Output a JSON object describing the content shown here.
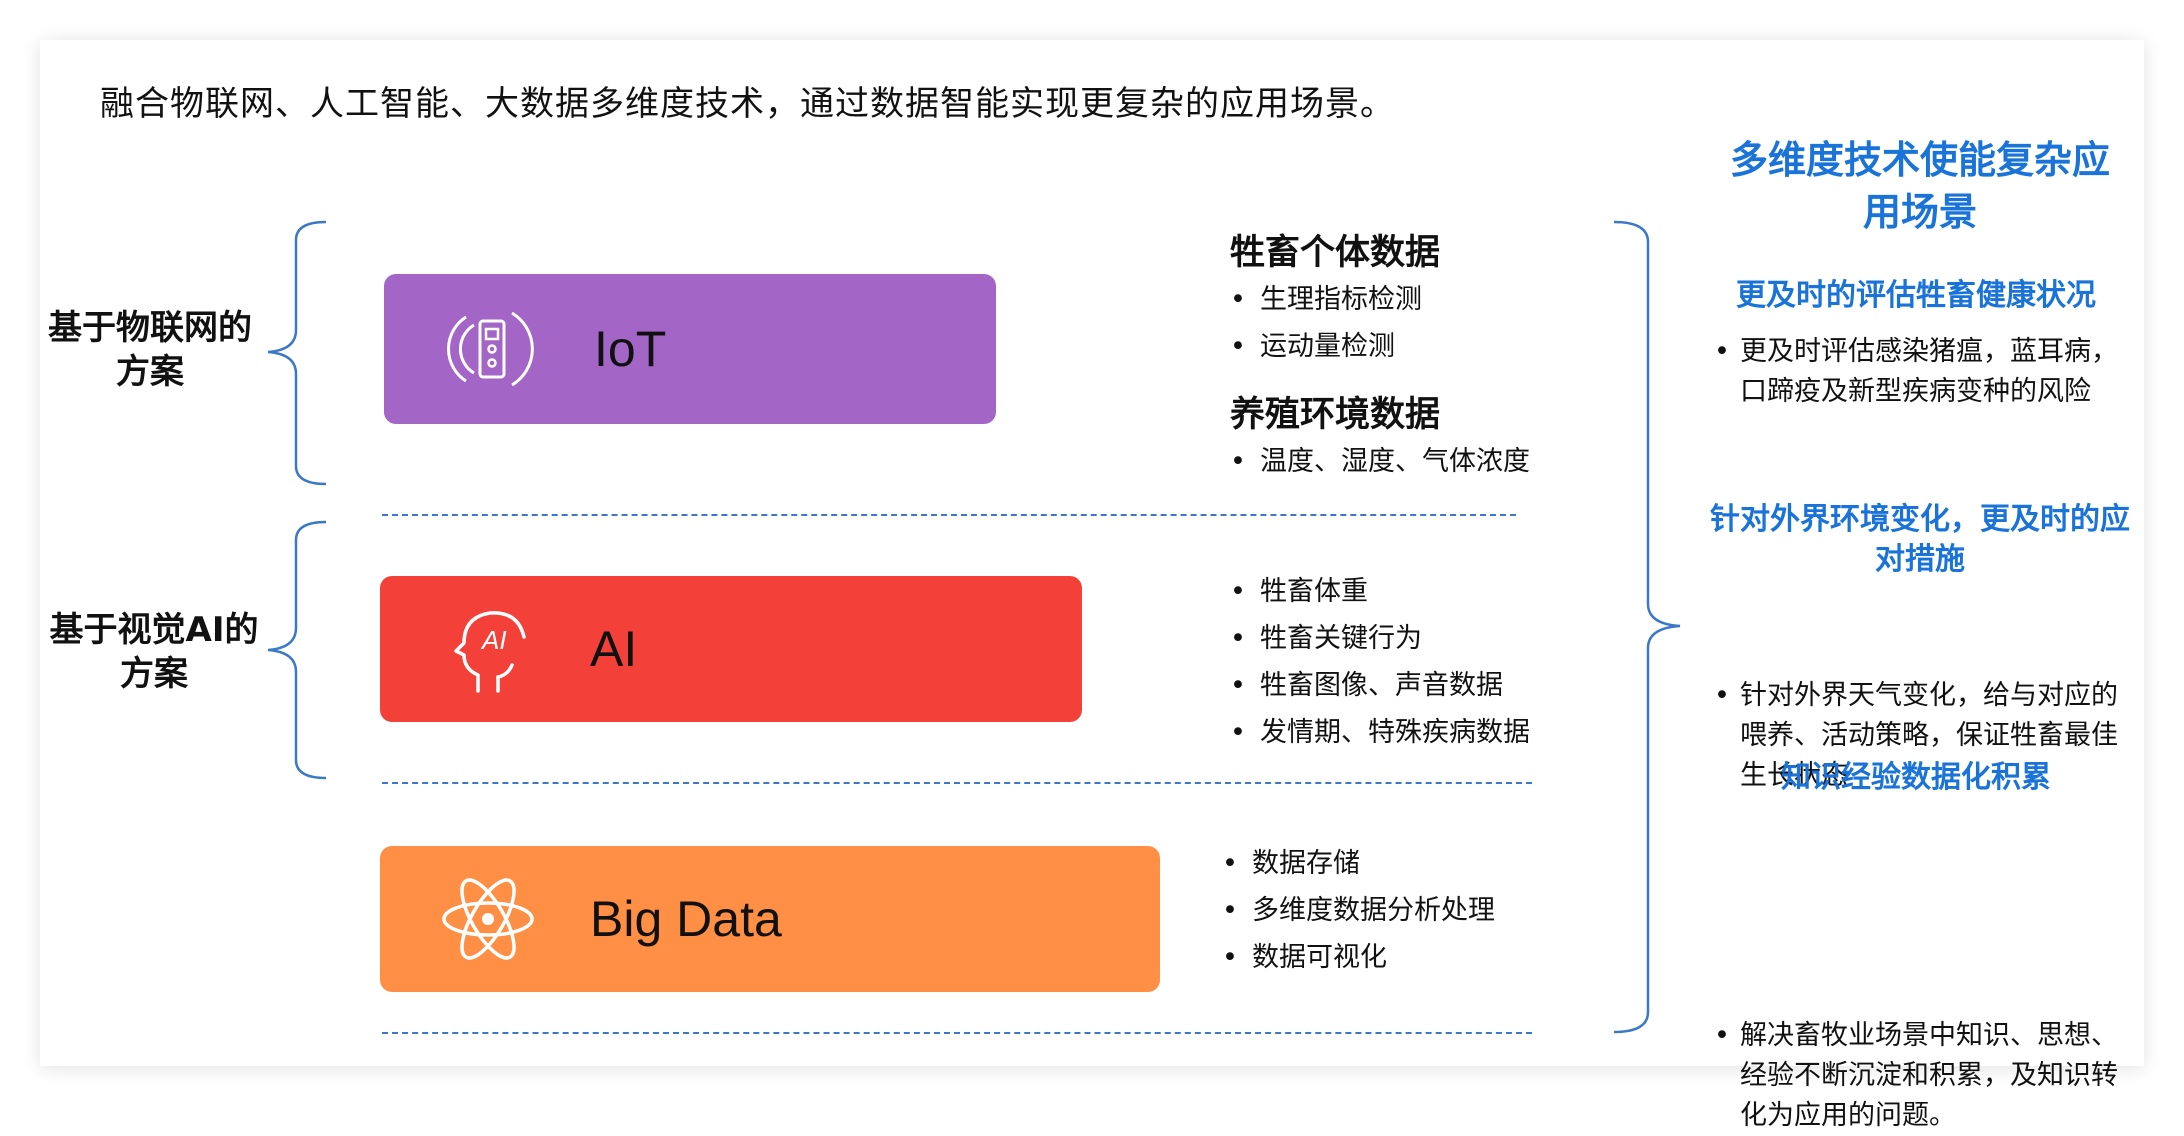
{
  "headline": "融合物联网、人工智能、大数据多维度技术，通过数据智能实现更复杂的应用场景。",
  "groups": [
    {
      "label": "基于物联网的方案"
    },
    {
      "label": "基于视觉AI的方案"
    }
  ],
  "techs": {
    "iot": {
      "label": "IoT",
      "icon": "iot-device-icon",
      "color": "#a366c7"
    },
    "ai": {
      "label": "AI",
      "icon": "ai-head-icon",
      "color": "#f3413a"
    },
    "bigdata": {
      "label": "Big Data",
      "icon": "atom-icon",
      "color": "#ff8f44"
    }
  },
  "iot_data": {
    "section1_title": "牲畜个体数据",
    "section1_items": [
      "生理指标检测",
      "运动量检测"
    ],
    "section2_title": "养殖环境数据",
    "section2_items": [
      "温度、湿度、气体浓度"
    ]
  },
  "ai_data": {
    "items": [
      "牲畜体重",
      "牲畜关键行为",
      "牲畜图像、声音数据",
      "发情期、特殊疾病数据"
    ]
  },
  "bigdata_data": {
    "items": [
      "数据存储",
      "多维度数据分析处理",
      "数据可视化"
    ]
  },
  "right": {
    "title": "多维度技术使能复杂应用场景",
    "accent_color": "#1a73d9",
    "blocks": [
      {
        "subtitle": "更及时的评估牲畜健康状况",
        "text": "更及时评估感染猪瘟，蓝耳病，口蹄疫及新型疾病变种的风险"
      },
      {
        "subtitle": "针对外界环境变化，更及时的应对措施",
        "text": "针对外界天气变化，给与对应的喂养、活动策略，保证牲畜最佳生长状态"
      },
      {
        "subtitle": "知识经验数据化积累",
        "text": "解决畜牧业场景中知识、思想、经验不断沉淀和积累，及知识转化为应用的问题。"
      }
    ]
  }
}
